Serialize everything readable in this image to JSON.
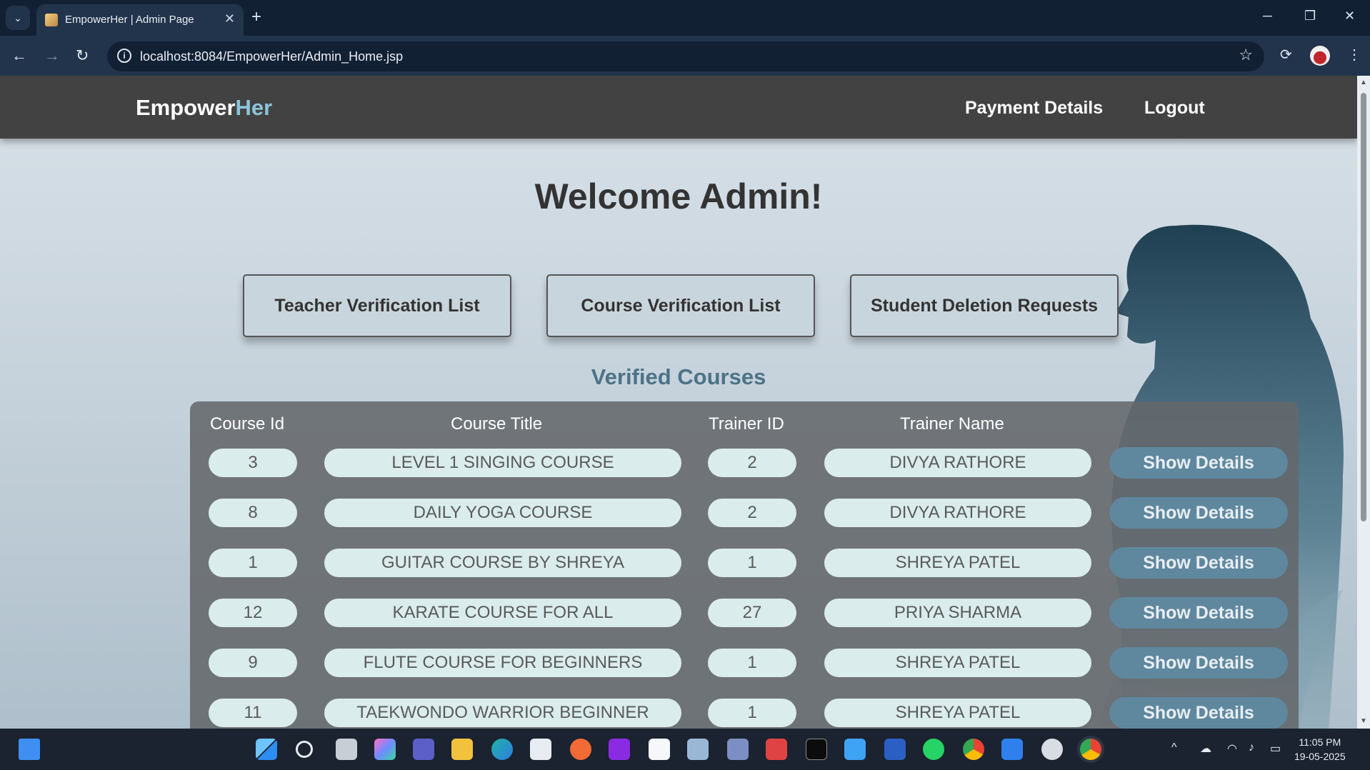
{
  "browser": {
    "tab_title": "EmpowerHer | Admin Page",
    "url": "localhost:8084/EmpowerHer/Admin_Home.jsp"
  },
  "header": {
    "brand_main": "Empower",
    "brand_accent": "Her",
    "nav": [
      "Payment Details",
      "Logout"
    ]
  },
  "welcome": "Welcome Admin!",
  "actions": [
    "Teacher Verification List",
    "Course Verification List",
    "Student Deletion Requests"
  ],
  "section_title": "Verified Courses",
  "table": {
    "columns": [
      "Course Id",
      "Course Title",
      "Trainer ID",
      "Trainer Name"
    ],
    "action_label": "Show Details",
    "rows": [
      [
        "3",
        "LEVEL 1 SINGING COURSE",
        "2",
        "DIVYA RATHORE"
      ],
      [
        "8",
        "DAILY YOGA COURSE",
        "2",
        "DIVYA RATHORE"
      ],
      [
        "1",
        "GUITAR COURSE BY SHREYA",
        "1",
        "SHREYA PATEL"
      ],
      [
        "12",
        "KARATE COURSE FOR ALL",
        "27",
        "PRIYA SHARMA"
      ],
      [
        "9",
        "FLUTE COURSE FOR BEGINNERS",
        "1",
        "SHREYA PATEL"
      ],
      [
        "11",
        "TAEKWONDO WARRIOR BEGINNER",
        "1",
        "SHREYA PATEL"
      ]
    ]
  },
  "taskbar": {
    "time": "11:05 PM",
    "date": "19-05-2025"
  },
  "colors": {
    "header_bg": "#424242",
    "brand_accent": "#8cc5d9",
    "section_title": "#4c7387",
    "cell_bg": "#daecec",
    "detail_button": "#5f889f"
  }
}
